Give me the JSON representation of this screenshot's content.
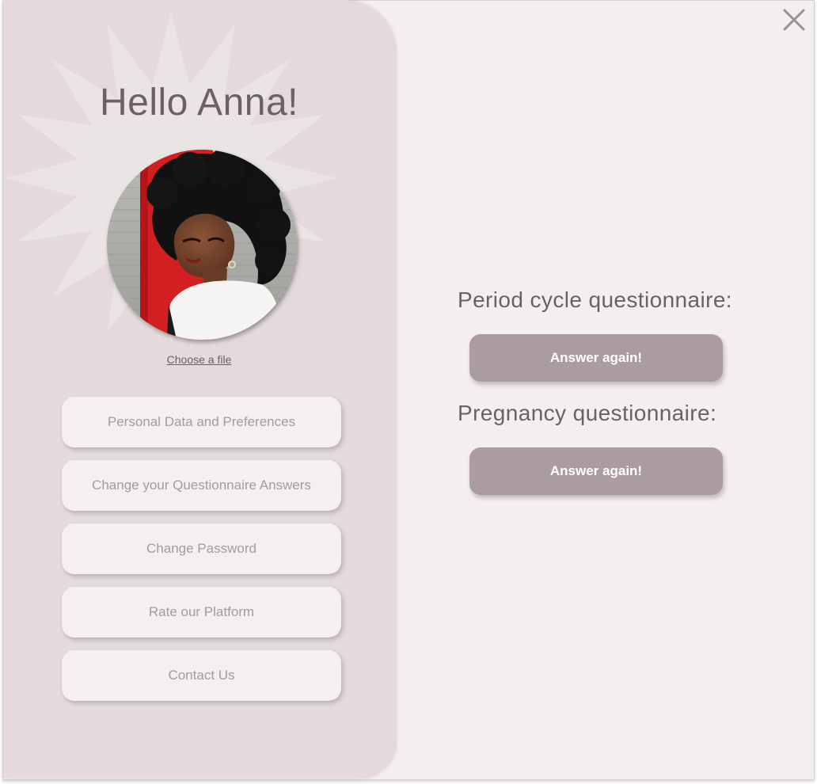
{
  "close": {
    "icon": "close-icon"
  },
  "profile": {
    "greeting": "Hello Anna!",
    "avatar": "profile-photo",
    "choose_file_label": "Choose a file"
  },
  "menu": {
    "items": [
      {
        "label": "Personal Data and Preferences"
      },
      {
        "label": "Change your Questionnaire Answers"
      },
      {
        "label": "Change Password"
      },
      {
        "label": "Rate our Platform"
      },
      {
        "label": "Contact Us"
      }
    ]
  },
  "questionnaires": [
    {
      "title": "Period cycle questionnaire:",
      "button_label": "Answer again!"
    },
    {
      "title": "Pregnancy questionnaire:",
      "button_label": "Answer again!"
    }
  ],
  "colors": {
    "panel_bg": "#f3eff0",
    "sidebar_bg": "#e4dadc",
    "accent_button": "#ab9ca4",
    "text_dark": "#6e6069",
    "text_muted": "#a6999f"
  }
}
